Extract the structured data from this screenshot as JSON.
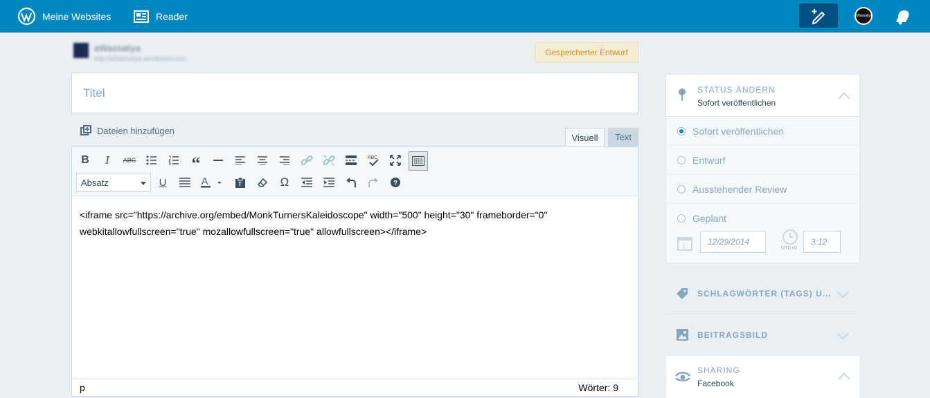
{
  "topbar": {
    "my_sites_label": "Meine Websites",
    "reader_label": "Reader",
    "avatar_text": "aWassatiya"
  },
  "site": {
    "name": "aWassatiya",
    "url": "http://aWassatiya.wordpress.com"
  },
  "editor": {
    "draft_status": "Gespeicherter Entwurf",
    "title_placeholder": "Titel",
    "add_files_label": "Dateien hinzufügen",
    "tab_visual": "Visuell",
    "tab_text": "Text",
    "format_select_value": "Absatz",
    "content": "<iframe src=\"https://archive.org/embed/MonkTurnersKaleidoscope\" width=\"500\" height=\"30\" frameborder=\"0\" webkitallowfullscreen=\"true\" mozallowfullscreen=\"true\" allowfullscreen></iframe>",
    "path": "p",
    "word_count": "Wörter: 9",
    "toolbar_row1": [
      "bold",
      "italic",
      "strikethrough",
      "bullet-list",
      "numbered-list",
      "blockquote",
      "horizontal-rule",
      "align-left",
      "align-center",
      "align-right",
      "insert-link",
      "remove-link",
      "read-more",
      "spellcheck",
      "fullscreen",
      "toolbar-toggle"
    ],
    "toolbar_row2": [
      "underline",
      "justify",
      "text-color",
      "paste-text",
      "clear-formatting",
      "special-character",
      "outdent",
      "indent",
      "undo",
      "redo",
      "help"
    ]
  },
  "sidebar": {
    "status": {
      "title": "STATUS ÄNDERN",
      "subtitle": "Sofort veröffentlichen",
      "options": [
        {
          "label": "Sofort veröffentlichen",
          "checked": true
        },
        {
          "label": "Entwurf",
          "checked": false
        },
        {
          "label": "Ausstehender Review",
          "checked": false
        },
        {
          "label": "Geplant",
          "checked": false
        }
      ],
      "date_value": "12/29/2014",
      "timezone": "UTC+0",
      "time_value": "3:12"
    },
    "tags_title": "SCHLAGWÖRTER (TAGS) U...",
    "featured_image_title": "BEITRAGSBILD",
    "sharing": {
      "title": "SHARING",
      "subtitle": "Facebook"
    }
  },
  "colors": {
    "topbar": "#0087be",
    "accent": "#0087be",
    "draft_badge": "#d9901a",
    "background": "#e9eff3"
  }
}
